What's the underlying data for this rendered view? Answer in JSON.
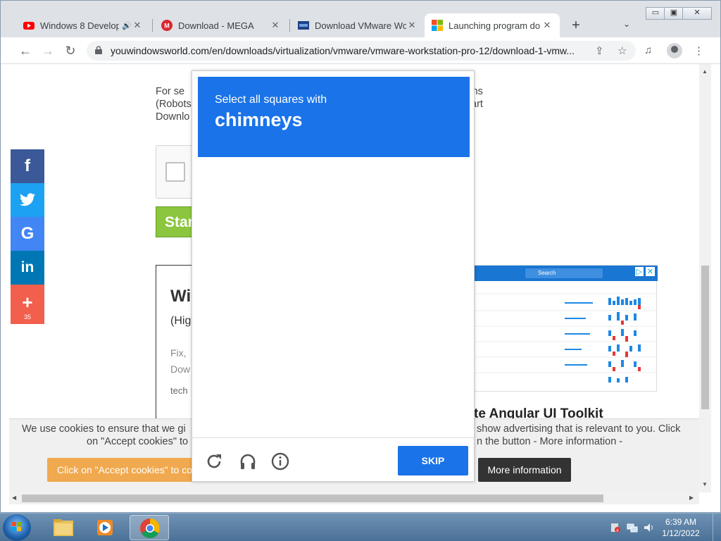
{
  "browser": {
    "tabs": [
      {
        "title": "Windows 8 Develop",
        "active": false
      },
      {
        "title": "Download - MEGA",
        "active": false
      },
      {
        "title": "Download VMware Wor",
        "active": false
      },
      {
        "title": "Launching program dow",
        "active": true
      }
    ],
    "url": "youwindowsworld.com/en/downloads/virtualization/vmware/vmware-workstation-pro-12/download-1-vmw...",
    "window_controls": {
      "minimize": "▭",
      "restore": "▣",
      "close": "✕"
    }
  },
  "page": {
    "article_lines": [
      "For se",
      "(Robots",
      "Downlo"
    ],
    "article_right": [
      "ns",
      "art"
    ],
    "start_button": "Star",
    "card": {
      "heading": "Wi",
      "sub": "(Hig",
      "p1": "Fix,",
      "p2": "Dow",
      "p3": "tech"
    },
    "ad_search": "Search",
    "ad_headline": "te Angular UI Toolkit",
    "share": {
      "count": "35"
    }
  },
  "cookie": {
    "text_left_1": "We use cookies to ensure that we gi",
    "text_right_1": "show advertising that is relevant to you. Click",
    "text_left_2": "on \"Accept cookies\" to",
    "text_right_2": "n the button - More information -",
    "accept_label": "Click on \"Accept cookies\" to co",
    "more_label": "More information"
  },
  "challenge": {
    "instruction": "Select all squares with",
    "target": "chimneys",
    "skip_label": "SKIP"
  },
  "taskbar": {
    "time": "6:39 AM",
    "date": "1/12/2022"
  },
  "colors": {
    "captcha_blue": "#1a73e8",
    "facebook": "#3b5998",
    "twitter": "#1da1f2",
    "google": "#4285f4",
    "linkedin": "#0077b5",
    "more": "#f25f4c",
    "start_green": "#8cc63f",
    "cookie_accept": "#f0a94f"
  }
}
